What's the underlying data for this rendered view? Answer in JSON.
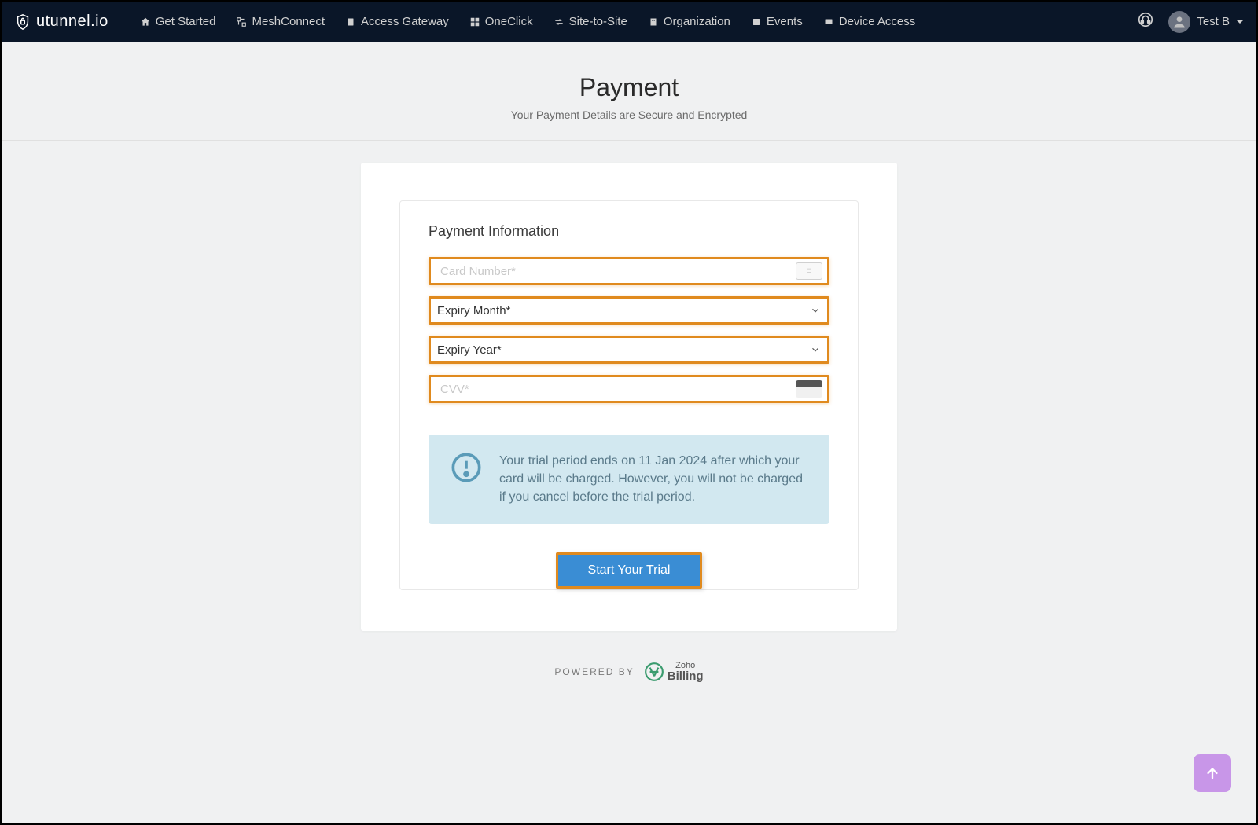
{
  "brand": {
    "name": "utunnel.io"
  },
  "nav": {
    "items": [
      {
        "label": "Get Started",
        "icon": "home"
      },
      {
        "label": "MeshConnect",
        "icon": "mesh"
      },
      {
        "label": "Access Gateway",
        "icon": "server"
      },
      {
        "label": "OneClick",
        "icon": "grid"
      },
      {
        "label": "Site-to-Site",
        "icon": "arrows"
      },
      {
        "label": "Organization",
        "icon": "building"
      },
      {
        "label": "Events",
        "icon": "list"
      },
      {
        "label": "Device Access",
        "icon": "monitor"
      }
    ],
    "user": "Test B"
  },
  "page": {
    "title": "Payment",
    "subtitle": "Your Payment Details are Secure and Encrypted"
  },
  "form": {
    "section_title": "Payment Information",
    "card_number": {
      "placeholder": "Card Number*",
      "value": ""
    },
    "expiry_month": {
      "label": "Expiry Month*"
    },
    "expiry_year": {
      "label": "Expiry Year*"
    },
    "cvv": {
      "placeholder": "CVV*",
      "value": ""
    }
  },
  "info": {
    "text": "Your trial period ends on 11 Jan 2024 after which your card will be charged. However, you will not be charged if you cancel before the trial period."
  },
  "cta": {
    "label": "Start Your Trial"
  },
  "footer": {
    "powered_by": "POWERED BY",
    "provider_top": "Zoho",
    "provider_bottom": "Billing"
  },
  "colors": {
    "highlight": "#e08a1e",
    "primary_btn": "#3a8dd4",
    "info_bg": "#d2e8f0",
    "fab": "#c896e8"
  }
}
